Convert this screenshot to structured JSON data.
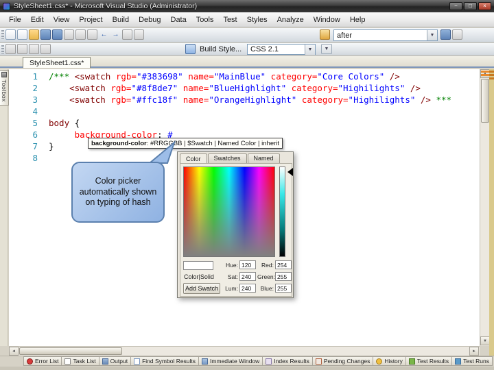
{
  "window": {
    "title": "StyleSheet1.css* - Microsoft Visual Studio (Administrator)"
  },
  "menu": [
    "File",
    "Edit",
    "View",
    "Project",
    "Build",
    "Debug",
    "Data",
    "Tools",
    "Test",
    "Styles",
    "Analyze",
    "Window",
    "Help"
  ],
  "toolbar_main": {
    "search_value": "after",
    "icons": [
      {
        "name": "new-file-icon",
        "type": "page"
      },
      {
        "name": "add-item-icon",
        "type": "page"
      },
      {
        "name": "open-file-icon",
        "type": "folder"
      },
      {
        "name": "save-icon",
        "type": "save"
      },
      {
        "name": "save-all-icon",
        "type": "save"
      },
      {
        "name": "cut-icon",
        "type": "gray"
      },
      {
        "name": "copy-icon",
        "type": "gray"
      },
      {
        "name": "paste-icon",
        "type": "gray"
      },
      {
        "name": "undo-icon",
        "type": "arrow-left"
      },
      {
        "name": "redo-icon",
        "type": "arrow-right"
      },
      {
        "name": "comment-icon",
        "type": "gray"
      },
      {
        "name": "uncomment-icon",
        "type": "gray"
      }
    ],
    "find_icon": {
      "name": "quick-find-icon",
      "type": "find"
    },
    "right_icons": [
      {
        "name": "find-next-icon",
        "type": "save"
      },
      {
        "name": "toolbar-options-icon",
        "type": "gray"
      }
    ]
  },
  "toolbar_style": {
    "icons": [
      {
        "name": "style-sheet-icon",
        "type": "gray"
      },
      {
        "name": "attach-style-icon",
        "type": "gray"
      },
      {
        "name": "manage-styles-icon",
        "type": "gray"
      },
      {
        "name": "style-options-icon",
        "type": "gray"
      }
    ],
    "build_style_icon": {
      "name": "build-style-icon",
      "type": "style"
    },
    "build_style_label": "Build Style...",
    "css_version": "CSS 2.1"
  },
  "document_tab": "StyleSheet1.css*",
  "toolbox_label": "Toolbox",
  "editor": {
    "lines": [
      {
        "n": "1",
        "segs": [
          [
            "/*** ",
            "com"
          ],
          [
            "<swatch ",
            "tag"
          ],
          [
            "rgb=",
            "attr"
          ],
          [
            "\"#383698\" ",
            "val"
          ],
          [
            "name=",
            "attr"
          ],
          [
            "\"MainBlue\" ",
            "val"
          ],
          [
            "category=",
            "attr"
          ],
          [
            "\"Core Colors\" ",
            "val"
          ],
          [
            "/>",
            "tag"
          ]
        ]
      },
      {
        "n": "2",
        "segs": [
          [
            "    ",
            "pln"
          ],
          [
            "<swatch ",
            "tag"
          ],
          [
            "rgb=",
            "attr"
          ],
          [
            "\"#8f8de7\" ",
            "val"
          ],
          [
            "name=",
            "attr"
          ],
          [
            "\"BlueHighlight\" ",
            "val"
          ],
          [
            "category=",
            "attr"
          ],
          [
            "\"Highilights\" ",
            "val"
          ],
          [
            "/>",
            "tag"
          ]
        ]
      },
      {
        "n": "3",
        "segs": [
          [
            "    ",
            "pln"
          ],
          [
            "<swatch ",
            "tag"
          ],
          [
            "rgb=",
            "attr"
          ],
          [
            "\"#ffc18f\" ",
            "val"
          ],
          [
            "name=",
            "attr"
          ],
          [
            "\"OrangeHighlight\" ",
            "val"
          ],
          [
            "category=",
            "attr"
          ],
          [
            "\"Highilights\" ",
            "val"
          ],
          [
            "/> ",
            "tag"
          ],
          [
            "***",
            "com"
          ]
        ]
      },
      {
        "n": "4",
        "segs": []
      },
      {
        "n": "5",
        "segs": [
          [
            "body ",
            "sel"
          ],
          [
            "{",
            "pln"
          ]
        ]
      },
      {
        "n": "6",
        "segs": [
          [
            "     ",
            "pln"
          ],
          [
            "background-color",
            "prop"
          ],
          [
            ": ",
            "pln"
          ],
          [
            "#",
            "hash"
          ]
        ]
      },
      {
        "n": "7",
        "segs": [
          [
            "}",
            "pln"
          ]
        ]
      },
      {
        "n": "8",
        "segs": []
      }
    ]
  },
  "tooltip": {
    "property": "background-color",
    "signature": ": #RRGGBB | $Swatch | Named Color | inherit"
  },
  "callout": {
    "text": "Color picker automatically shown on typing of hash"
  },
  "color_picker": {
    "tabs": [
      "Color",
      "Swatches",
      "Named"
    ],
    "active_tab": "Color",
    "hex_input": "",
    "mode_label": "Color|Solid",
    "add_swatch_button": "Add Swatch",
    "hsl": [
      [
        "Hue:",
        "120"
      ],
      [
        "Sat:",
        "240"
      ],
      [
        "Lum:",
        "240"
      ]
    ],
    "rgb": [
      [
        "Red:",
        "254"
      ],
      [
        "Green:",
        "255"
      ],
      [
        "Blue:",
        "255"
      ]
    ]
  },
  "bottom_tabs": [
    {
      "label": "Error List",
      "icon": "i-error",
      "iname": "error-list-icon"
    },
    {
      "label": "Task List",
      "icon": "i-task",
      "iname": "task-list-icon"
    },
    {
      "label": "Output",
      "icon": "i-output",
      "iname": "output-icon"
    },
    {
      "label": "Find Symbol Results",
      "icon": "i-findsym",
      "iname": "find-symbol-results-icon"
    },
    {
      "label": "Immediate Window",
      "icon": "i-immediate",
      "iname": "immediate-window-icon"
    },
    {
      "label": "Index Results",
      "icon": "i-index",
      "iname": "index-results-icon"
    },
    {
      "label": "Pending Changes",
      "icon": "i-pending",
      "iname": "pending-changes-icon"
    },
    {
      "label": "History",
      "icon": "i-history",
      "iname": "history-icon"
    },
    {
      "label": "Test Results",
      "icon": "i-testres",
      "iname": "test-results-icon"
    },
    {
      "label": "Test Runs",
      "icon": "i-testruns",
      "iname": "test-runs-icon"
    }
  ],
  "window_buttons": {
    "minimize": "−",
    "maximize": "□",
    "close": "×"
  },
  "colors": {
    "accent_band": "#d9c98c",
    "scroll_mark": "#e8892c",
    "callout_fill": "#9dbde8"
  }
}
